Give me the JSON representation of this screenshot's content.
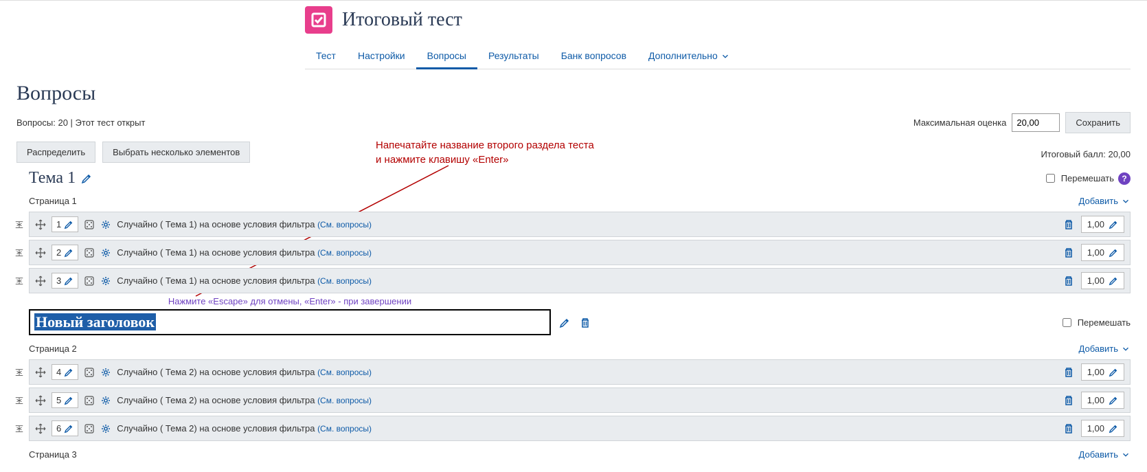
{
  "header": {
    "title": "Итоговый тест",
    "tabs": [
      "Тест",
      "Настройки",
      "Вопросы",
      "Результаты",
      "Банк вопросов",
      "Дополнительно"
    ],
    "active_tab_index": 2
  },
  "section_heading": "Вопросы",
  "meta": {
    "count_label": "Вопросы: 20",
    "sep": " | ",
    "status": "Этот тест открыт",
    "max_grade_label": "Максимальная оценка",
    "max_grade_value": "20,00",
    "save_label": "Сохранить"
  },
  "buttons": {
    "repaginate": "Распределить",
    "select_multiple": "Выбрать несколько элементов"
  },
  "total_label": "Итоговый балл: 20,00",
  "annotation": {
    "line1": "Напечатайте название второго раздела теста",
    "line2": "и нажмите клавишу «Enter»"
  },
  "sections": [
    {
      "title": "Тема 1",
      "shuffle_label": "Перемешать",
      "pages": [
        {
          "label": "Страница 1",
          "add_label": "Добавить",
          "questions": [
            {
              "num": "1",
              "text": "Случайно ( Тема 1) на основе условия фильтра",
              "see": "(См. вопросы)",
              "mark": "1,00"
            },
            {
              "num": "2",
              "text": "Случайно ( Тема 1) на основе условия фильтра",
              "see": "(См. вопросы)",
              "mark": "1,00"
            },
            {
              "num": "3",
              "text": "Случайно ( Тема 1) на основе условия фильтра",
              "see": "(См. вопросы)",
              "mark": "1,00"
            }
          ]
        }
      ]
    },
    {
      "editing": true,
      "esc_hint": "Нажмите «Escape» для отмены, «Enter» - при завершении",
      "input_placeholder": "Новый заголовок",
      "shuffle_label": "Перемешать",
      "pages": [
        {
          "label": "Страница 2",
          "add_label": "Добавить",
          "questions": [
            {
              "num": "4",
              "text": "Случайно ( Тема 2) на основе условия фильтра",
              "see": "(См. вопросы)",
              "mark": "1,00"
            },
            {
              "num": "5",
              "text": "Случайно ( Тема 2) на основе условия фильтра",
              "see": "(См. вопросы)",
              "mark": "1,00"
            },
            {
              "num": "6",
              "text": "Случайно ( Тема 2) на основе условия фильтра",
              "see": "(См. вопросы)",
              "mark": "1,00"
            }
          ]
        },
        {
          "label": "Страница 3",
          "add_label": "Добавить",
          "questions": []
        }
      ]
    }
  ]
}
